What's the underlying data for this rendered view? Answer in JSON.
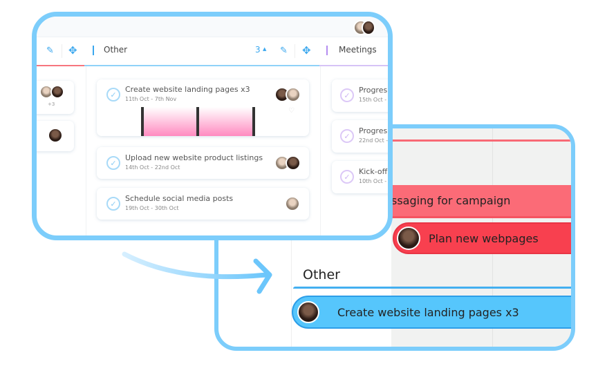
{
  "front": {
    "column_header": {
      "other_label": "Other",
      "other_count": "3",
      "meetings_label": "Meetings",
      "left_count_badge": "+3"
    },
    "other_cards": [
      {
        "title": "Create website landing pages x3",
        "dates": "11th Oct - 7th Nov"
      },
      {
        "title": "Upload new website product listings",
        "dates": "14th Oct - 22nd Oct"
      },
      {
        "title": "Schedule social media posts",
        "dates": "19th Oct - 30th Oct"
      }
    ],
    "meeting_cards": [
      {
        "title": "Progres",
        "dates": "15th Oct -"
      },
      {
        "title": "Progres",
        "dates": "22nd Oct -"
      },
      {
        "title": "Kick-off",
        "dates": "10th Oct -"
      }
    ]
  },
  "back": {
    "bars": [
      {
        "label": "ssaging for campaign",
        "color": "#fb6b77"
      },
      {
        "label": "Plan new webpages",
        "color": "#f8404f"
      },
      {
        "label": "Create website landing pages x3",
        "color": "#56c6fc"
      }
    ],
    "group_label": "Other"
  },
  "colors": {
    "frame": "#7ccdfb",
    "red": "#f8404f",
    "blue": "#56c6fc",
    "purple": "#b48cf0"
  }
}
